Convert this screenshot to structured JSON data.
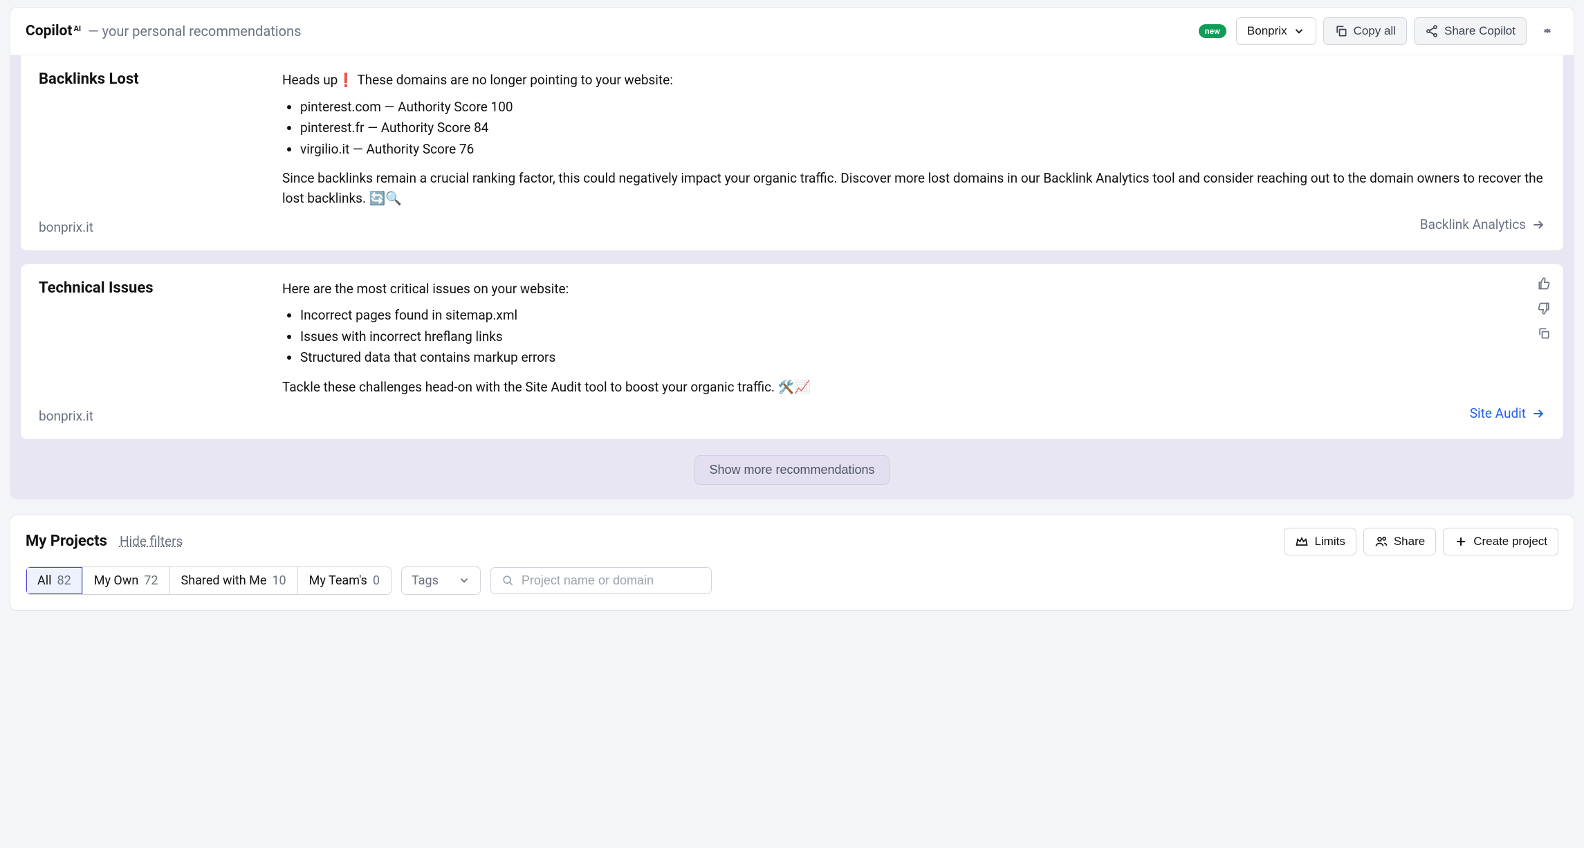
{
  "header": {
    "title": "Copilot",
    "title_sup": "AI",
    "subtitle": "— your personal recommendations",
    "badge": "new",
    "project_selector": "Bonprix",
    "copy_all": "Copy all",
    "share": "Share Copilot"
  },
  "cards": [
    {
      "title": "Backlinks Lost",
      "domain": "bonprix.it",
      "intro": "Heads up❗ These domains are no longer pointing to your website:",
      "items": [
        "pinterest.com — Authority Score 100",
        "pinterest.fr — Authority Score 84",
        "virgilio.it — Authority Score 76"
      ],
      "outro": "Since backlinks remain a crucial ranking factor, this could negatively impact your organic traffic. Discover more lost domains in our Backlink Analytics tool and consider reaching out to the domain owners to recover the lost backlinks. 🔄🔍",
      "link": "Backlink Analytics",
      "link_style": "gray"
    },
    {
      "title": "Technical Issues",
      "domain": "bonprix.it",
      "intro": "Here are the most critical issues on your website:",
      "items": [
        "Incorrect pages found in sitemap.xml",
        "Issues with incorrect hreflang links",
        "Structured data that contains markup errors"
      ],
      "outro": "Tackle these challenges head-on with the Site Audit tool to boost your organic traffic. 🛠️📈",
      "link": "Site Audit",
      "link_style": "blue"
    }
  ],
  "show_more": "Show more recommendations",
  "projects": {
    "title": "My Projects",
    "hide_filters": "Hide filters",
    "limits": "Limits",
    "share": "Share",
    "create": "Create project",
    "tabs": [
      {
        "label": "All",
        "count": "82",
        "active": true
      },
      {
        "label": "My Own",
        "count": "72",
        "active": false
      },
      {
        "label": "Shared with Me",
        "count": "10",
        "active": false
      },
      {
        "label": "My Team's",
        "count": "0",
        "active": false
      }
    ],
    "tags_label": "Tags",
    "search_placeholder": "Project name or domain"
  }
}
